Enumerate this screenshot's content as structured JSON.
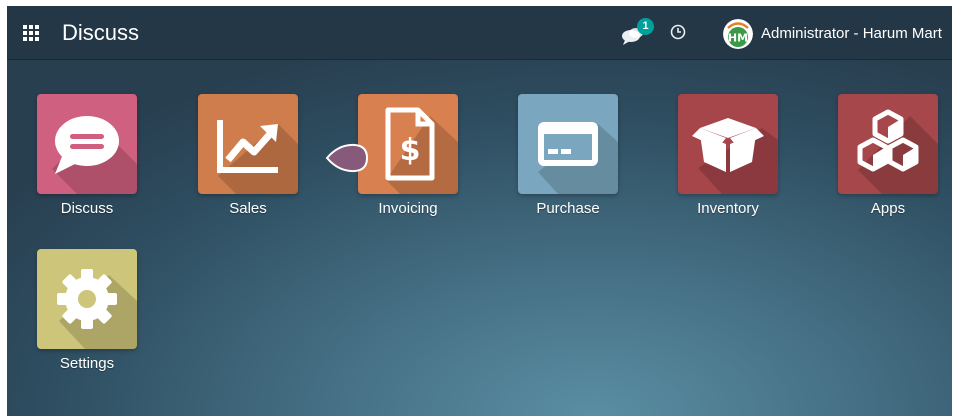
{
  "header": {
    "app_title": "Discuss",
    "chat_count": "1",
    "user_name": "Administrator - Harum Mart",
    "avatar_initials": "HM"
  },
  "apps": [
    {
      "label": "Discuss",
      "icon": "chat-bubble-icon",
      "color": "#d0607f"
    },
    {
      "label": "Sales",
      "icon": "trending-chart-icon",
      "color": "#cf7d4d"
    },
    {
      "label": "Invoicing",
      "icon": "invoice-dollar-icon",
      "color": "#d8804f"
    },
    {
      "label": "Purchase",
      "icon": "credit-card-icon",
      "color": "#7aa7bf"
    },
    {
      "label": "Inventory",
      "icon": "open-box-icon",
      "color": "#a6454a"
    },
    {
      "label": "Apps",
      "icon": "cubes-icon",
      "color": "#a5474b"
    },
    {
      "label": "Settings",
      "icon": "gear-icon",
      "color": "#cdc57a"
    }
  ],
  "colors": {
    "topbar": "#243746",
    "badge": "#00a09d",
    "bubble": "#875a7b"
  }
}
